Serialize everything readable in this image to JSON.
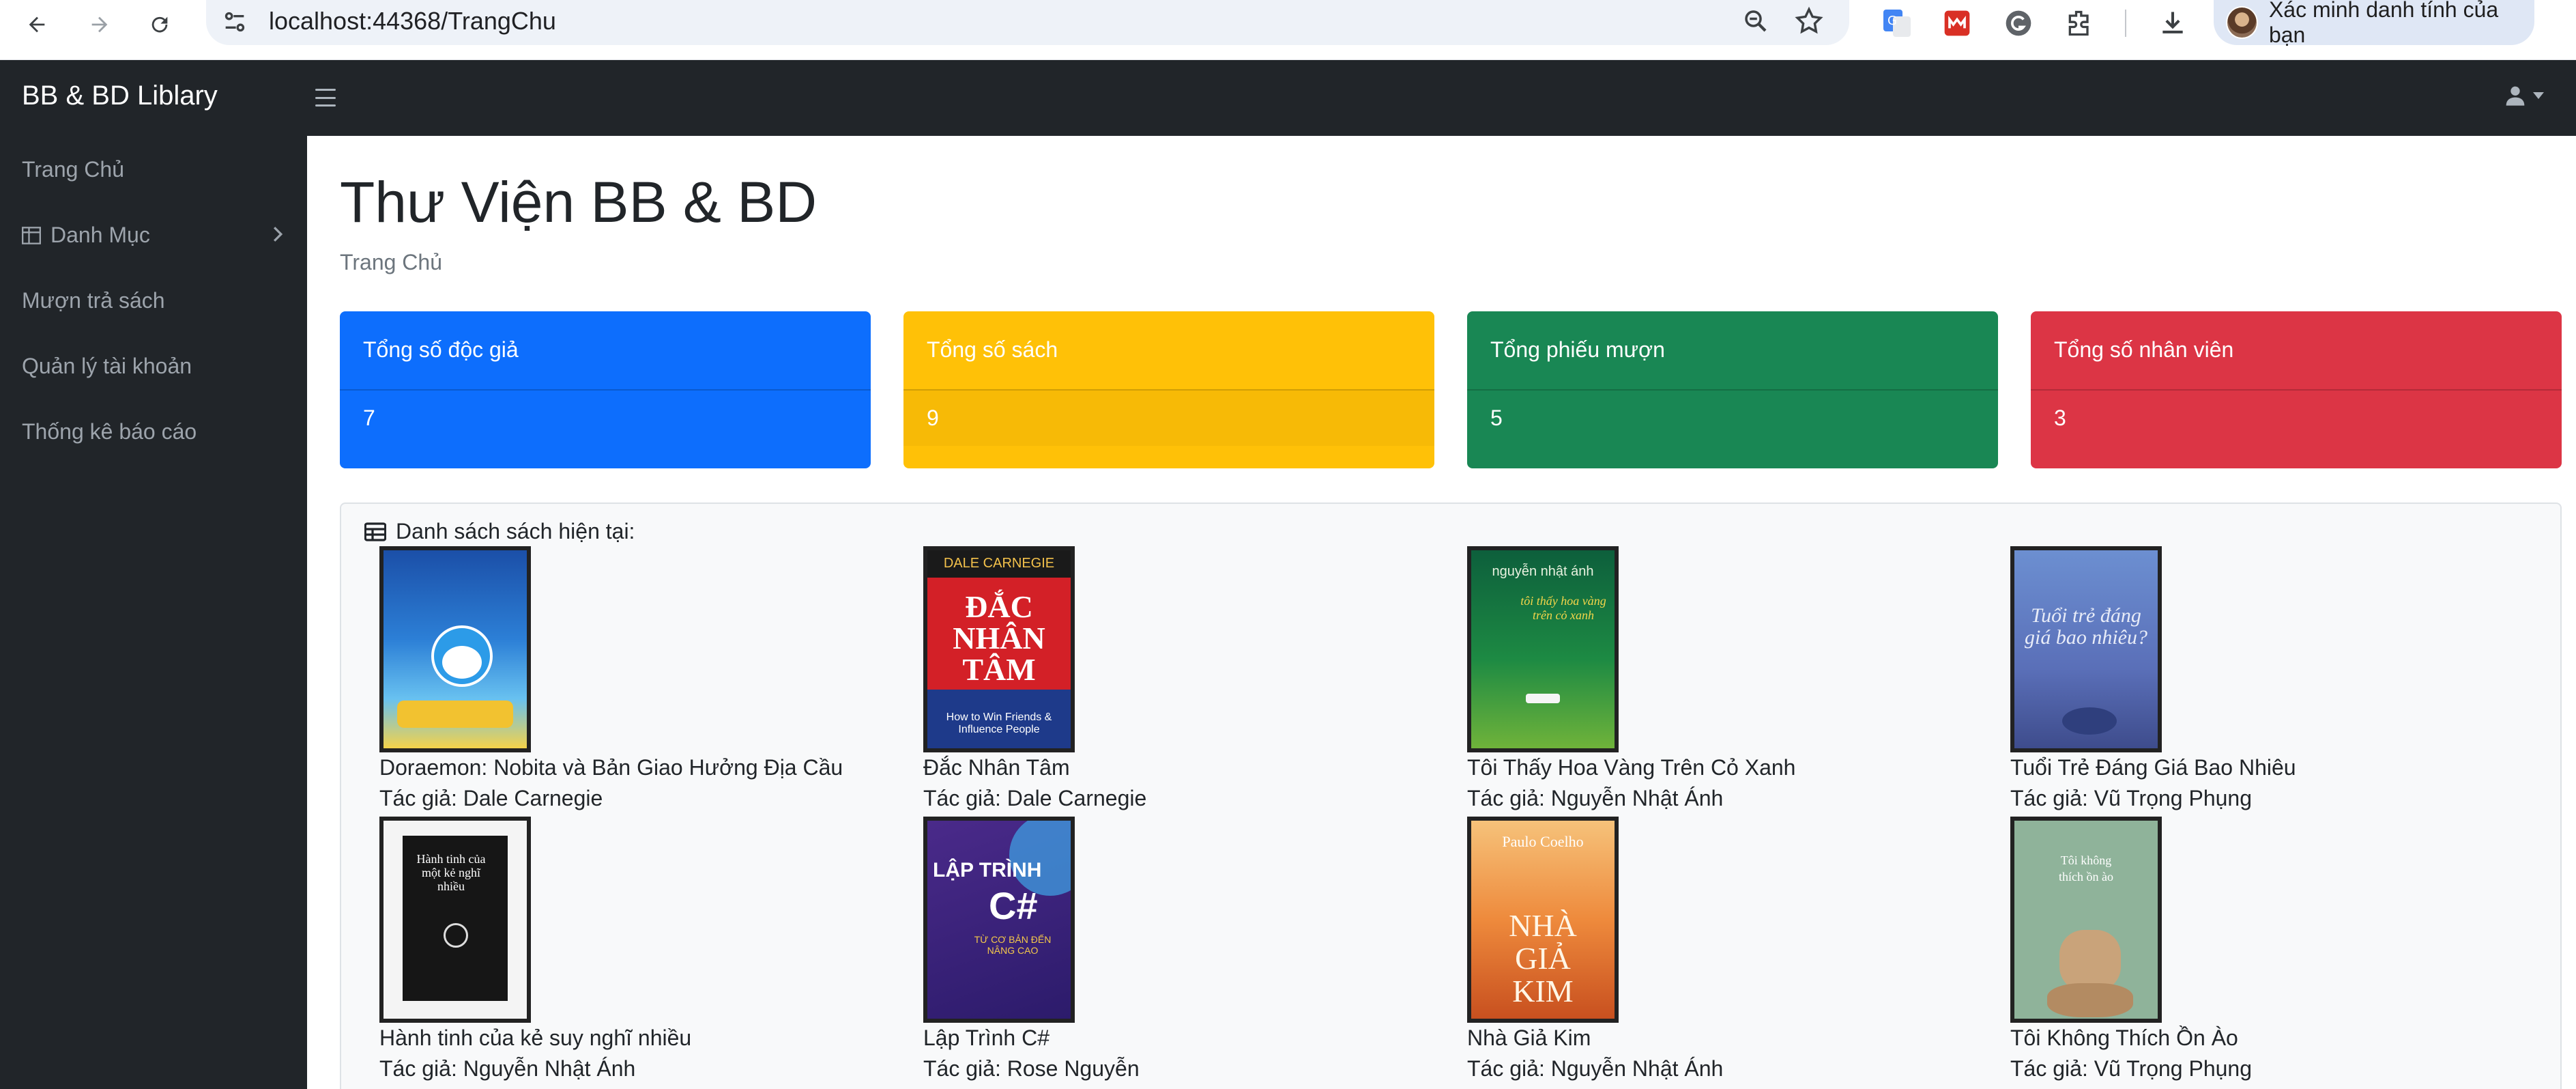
{
  "browser": {
    "url": "localhost:44368/TrangChu",
    "profile_label": "Xác minh danh tính của bạn"
  },
  "app": {
    "brand": "BB & BD Liblary"
  },
  "sidebar": {
    "items": [
      {
        "label": "Trang Chủ"
      },
      {
        "label": "Danh Mục"
      },
      {
        "label": "Mượn trả sách"
      },
      {
        "label": "Quản lý tài khoản"
      },
      {
        "label": "Thống kê báo cáo"
      }
    ]
  },
  "page": {
    "title": "Thư Viện BB & BD",
    "breadcrumb": "Trang Chủ"
  },
  "stats": [
    {
      "label": "Tổng số độc giả",
      "value": "7",
      "color": "#0d6efd"
    },
    {
      "label": "Tổng số sách",
      "value": "9",
      "color": "#ffc107"
    },
    {
      "label": "Tổng phiếu mượn",
      "value": "5",
      "color": "#198754"
    },
    {
      "label": "Tổng số nhân viên",
      "value": "3",
      "color": "#dc3545"
    }
  ],
  "books": {
    "heading": "Danh sách sách hiện tại:",
    "items": [
      {
        "title": "Doraemon: Nobita và Bản Giao Hưởng Địa Cầu",
        "author": "Tác giả: Dale Carnegie"
      },
      {
        "title": "Đắc Nhân Tâm",
        "author": "Tác giả: Dale Carnegie"
      },
      {
        "title": "Tôi Thấy Hoa Vàng Trên Cỏ Xanh",
        "author": "Tác giả: Nguyễn Nhật Ánh"
      },
      {
        "title": "Tuổi Trẻ Đáng Giá Bao Nhiêu",
        "author": "Tác giả: Vũ Trọng Phụng"
      },
      {
        "title": "Hành tinh của kẻ suy nghĩ nhiều",
        "author": "Tác giả: Nguyễn Nhật Ánh"
      },
      {
        "title": "Lập Trình C#",
        "author": "Tác giả: Rose Nguyễn"
      },
      {
        "title": "Nhà Giả Kim",
        "author": "Tác giả: Nguyễn Nhật Ánh"
      },
      {
        "title": "Tôi Không Thích Ồn Ào",
        "author": "Tác giả: Vũ Trọng Phụng"
      }
    ]
  },
  "covers": {
    "b2_top": "DALE CARNEGIE",
    "b2_main": "ĐẮC NHÂN TÂM",
    "b2_sub": "How to Win Friends & Influence People",
    "b3_top": "nguyễn nhật ánh",
    "b3_main": "tôi thấy hoa vàng trên cỏ xanh",
    "b4_main": "Tuổi trẻ đáng giá bao nhiêu?",
    "b5_main": "Hành tinh của một kẻ nghĩ nhiều",
    "b6_main": "LẬP TRÌNH",
    "b6_big": "C#",
    "b6_sub": "TỪ CƠ BẢN ĐẾN NÂNG CAO",
    "b7_top": "Paulo Coelho",
    "b7_main": "NHÀ GIẢ KIM",
    "b8_main": "Tôi không thích ồn ào"
  }
}
